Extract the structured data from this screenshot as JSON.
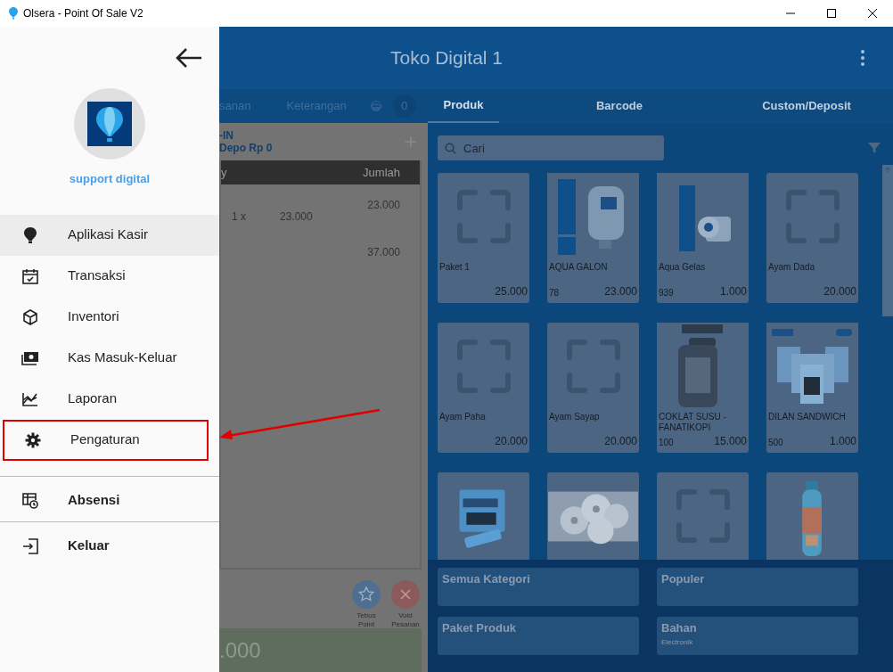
{
  "window": {
    "title": "Olsera - Point Of Sale V2"
  },
  "header": {
    "title": "Toko Digital 1"
  },
  "order_tabs": [
    {
      "label": "sanan"
    },
    {
      "label": "Keterangan"
    }
  ],
  "order_count": "0",
  "cart": {
    "customer_lines": [
      "-IN",
      "Depo Rp 0"
    ],
    "columns": [
      "y",
      "Jumlah"
    ],
    "rows": [
      {
        "qty": "1 x",
        "price": "23.000",
        "amount": "23.000"
      },
      {
        "amount": "37.000"
      }
    ]
  },
  "actions": [
    {
      "label": "Tebus Point",
      "kind": "point"
    },
    {
      "label": "Void Pesanan",
      "kind": "void"
    }
  ],
  "total": ".000",
  "product_tabs": [
    {
      "label": "Produk",
      "selected": true
    },
    {
      "label": "Barcode",
      "selected": false
    },
    {
      "label": "Custom/Deposit",
      "selected": false
    }
  ],
  "search": {
    "placeholder": "Cari"
  },
  "products": [
    {
      "name": "Paket 1",
      "price": "25.000",
      "kind": "placeholder"
    },
    {
      "name": "AQUA GALON",
      "stock": "78",
      "price": "23.000",
      "kind": "picture"
    },
    {
      "name": "Aqua Gelas",
      "stock": "939",
      "price": "1.000",
      "kind": "picture"
    },
    {
      "name": "Ayam Dada",
      "price": "20.000",
      "kind": "placeholder"
    },
    {
      "name": "Ayam Paha",
      "price": "20.000",
      "kind": "placeholder"
    },
    {
      "name": "Ayam Sayap",
      "price": "20.000",
      "kind": "placeholder"
    },
    {
      "name": "COKLAT SUSU - FANATIKOPI",
      "stock": "100",
      "price": "15.000",
      "kind": "picture"
    },
    {
      "name": "DILAN SANDWICH",
      "stock": "500",
      "price": "1.000",
      "kind": "picture"
    },
    {
      "kind": "picture"
    },
    {
      "kind": "picture"
    },
    {
      "kind": "placeholder"
    },
    {
      "kind": "picture"
    }
  ],
  "categories": [
    {
      "name": "Semua Kategori"
    },
    {
      "name": "Populer"
    },
    {
      "name": "Paket Produk"
    },
    {
      "name": "Bahan",
      "subtitle": "Electronik"
    }
  ],
  "drawer": {
    "user": "support digital",
    "items": [
      {
        "label": "Aplikasi Kasir",
        "selected": true,
        "highlighted": false
      },
      {
        "label": "Transaksi",
        "selected": false,
        "highlighted": false
      },
      {
        "label": "Inventori",
        "selected": false,
        "highlighted": false
      },
      {
        "label": "Kas Masuk-Keluar",
        "selected": false,
        "highlighted": false
      },
      {
        "label": "Laporan",
        "selected": false,
        "highlighted": false
      },
      {
        "label": "Pengaturan",
        "selected": false,
        "highlighted": true
      }
    ],
    "bottom_items": [
      {
        "label": "Absensi"
      },
      {
        "label": "Keluar"
      }
    ]
  }
}
